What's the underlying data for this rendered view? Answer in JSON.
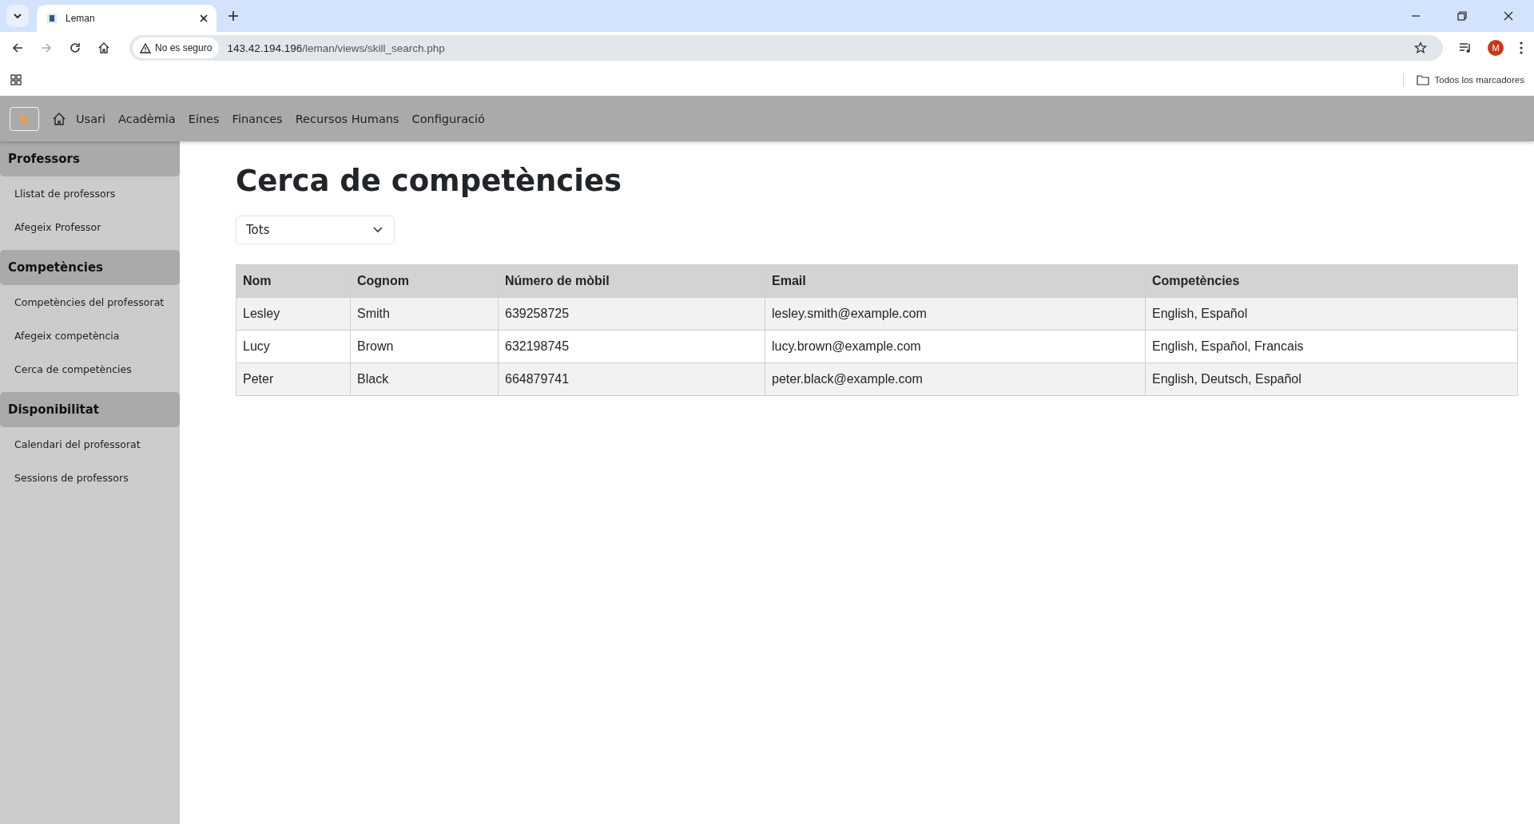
{
  "browser": {
    "tab": {
      "title": "Leman"
    },
    "security": "No es seguro",
    "url_host": "143.42.194.196",
    "url_path": "/leman/views/skill_search.php",
    "profile": "M",
    "bookmarks_label": "Todos los marcadores"
  },
  "navbar": {
    "items": [
      "Usari",
      "Acadèmia",
      "Eines",
      "Finances",
      "Recursos Humans",
      "Configuració"
    ]
  },
  "sidebar": {
    "sections": [
      {
        "title": "Professors",
        "items": [
          "Llistat de professors",
          "Afegeix Professor"
        ]
      },
      {
        "title": "Competències",
        "items": [
          "Competències del professorat",
          "Afegeix competència",
          "Cerca de competències"
        ]
      },
      {
        "title": "Disponibilitat",
        "items": [
          "Calendari del professorat",
          "Sessions de professors"
        ]
      }
    ]
  },
  "page": {
    "title": "Cerca de competències",
    "filter": {
      "value": "Tots"
    }
  },
  "table": {
    "columns": [
      "Nom",
      "Cognom",
      "Número de mòbil",
      "Email",
      "Competències"
    ],
    "rows": [
      [
        "Lesley",
        "Smith",
        "639258725",
        "lesley.smith@example.com",
        "English, Español"
      ],
      [
        "Lucy",
        "Brown",
        "632198745",
        "lucy.brown@example.com",
        "English, Español, Francais"
      ],
      [
        "Peter",
        "Black",
        "664879741",
        "peter.black@example.com",
        "English, Deutsch, Español"
      ]
    ]
  }
}
